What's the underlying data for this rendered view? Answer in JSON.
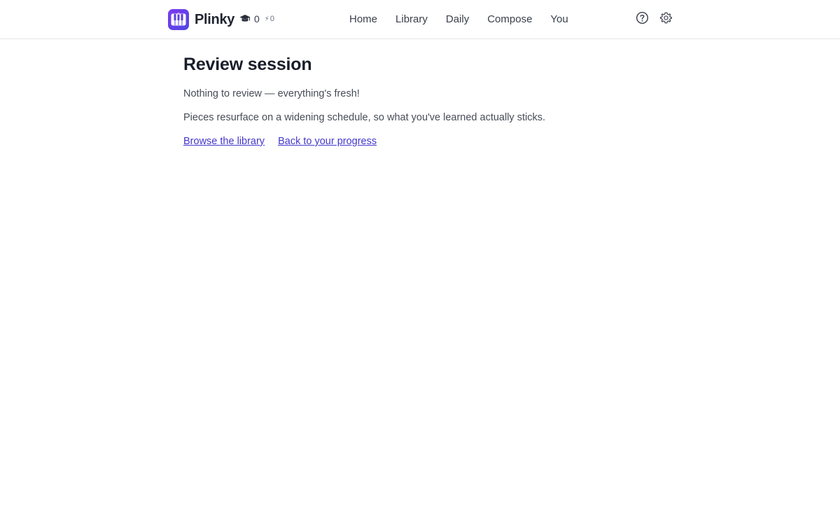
{
  "app": {
    "name": "Plinky",
    "brand_color": "#5b3fe0"
  },
  "header": {
    "stats": {
      "icon": "graduation-cap-icon",
      "count": "0",
      "streak_icon": "bolt-icon",
      "streak": "0"
    },
    "nav": [
      {
        "label": "Home"
      },
      {
        "label": "Library"
      },
      {
        "label": "Daily"
      },
      {
        "label": "Compose"
      },
      {
        "label": "You"
      }
    ],
    "icons": {
      "help": "help-circle-icon",
      "settings": "gear-icon"
    }
  },
  "main": {
    "title": "Review session",
    "empty_message": "Nothing to review — everything's fresh!",
    "explanation": "Pieces resurface on a widening schedule, so what you've learned actually sticks.",
    "links": {
      "browse": "Browse the library",
      "progress": "Back to your progress"
    },
    "link_color": "#4338ca"
  }
}
